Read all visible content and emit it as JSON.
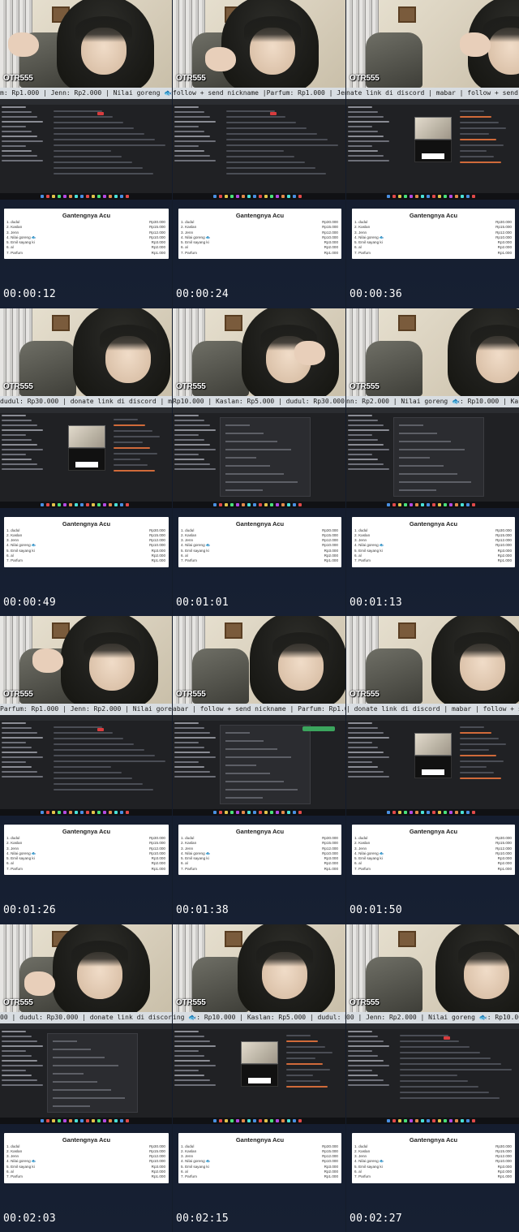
{
  "watermark": "OTR555",
  "leaderboard": {
    "title": "Gantengnya Acu",
    "rows": [
      {
        "name": "1. dudul",
        "value": "Rp30.000"
      },
      {
        "name": "2. Kaslan",
        "value": "Rp15.000"
      },
      {
        "name": "3. Jenn",
        "value": "Rp12.000"
      },
      {
        "name": "4. Nilai goreng 🐟",
        "value": "Rp10.000"
      },
      {
        "name": "5. Emil sayang ki",
        "value": "Rp3.000"
      },
      {
        "name": "6. al",
        "value": "Rp2.000"
      },
      {
        "name": "7. Parfum",
        "value": "Rp1.000"
      }
    ]
  },
  "tiles": [
    {
      "timestamp": "00:00:12",
      "ticker": "m: Rp1.000 | Jenn: Rp2.000 | Nilai goreng 🐟: Rp"
    },
    {
      "timestamp": "00:00:24",
      "ticker": "follow + send nickname |Parfum: Rp1.000 | Jenn:"
    },
    {
      "timestamp": "00:00:36",
      "ticker": "nate link di discord | mabar | follow + send ni"
    },
    {
      "timestamp": "00:00:49",
      "ticker": "dudul: Rp30.000 | donate link di discord | mabar"
    },
    {
      "timestamp": "00:01:01",
      "ticker": "Rp10.000 | Kaslan: Rp5.000 | dudul: Rp30.000 | J"
    },
    {
      "timestamp": "00:01:13",
      "ticker": "nn: Rp2.000 | Nilai goreng 🐟: Rp10.000 | Kaslan"
    },
    {
      "timestamp": "00:01:26",
      "ticker": "Parfum: Rp1.000 | Jenn: Rp2.000 | Nilai goreng 🐟"
    },
    {
      "timestamp": "00:01:38",
      "ticker": "abar | follow + send nickname | Parfum: Rp1.000 |"
    },
    {
      "timestamp": "00:01:50",
      "ticker": "| donate link di discord | mabar | follow + se"
    },
    {
      "timestamp": "00:02:03",
      "ticker": "00 | dudul: Rp30.000 | donate link di discord |"
    },
    {
      "timestamp": "00:02:15",
      "ticker": "ing 🐟: Rp10.000 | Kaslan: Rp5.000 | dudul: Rp30.0"
    },
    {
      "timestamp": "00:02:27",
      "ticker": "00 | Jenn: Rp2.000 | Nilai goreng 🐟: Rp10.000 | Kaslan"
    }
  ],
  "colors": {
    "background": "#141c2a",
    "ticker_bg": "#d8dde2",
    "screen_bg": "#202124",
    "accent_red": "#d83c3e",
    "accent_green": "#3ba55d"
  }
}
